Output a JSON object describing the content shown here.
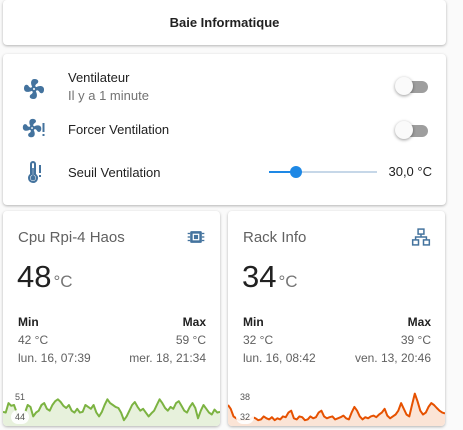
{
  "header": {
    "title": "Baie Informatique"
  },
  "entities": [
    {
      "icon": "fan-icon",
      "name": "Ventilateur",
      "secondary": "Il y a 1 minute",
      "type": "toggle",
      "state": "off"
    },
    {
      "icon": "fan-alert-icon",
      "name": "Forcer Ventilation",
      "type": "toggle",
      "state": "off"
    },
    {
      "icon": "thermometer-alert-icon",
      "name": "Seuil Ventilation",
      "type": "slider",
      "value_text": "30,0 °C",
      "level": 0.25
    }
  ],
  "sensors": [
    {
      "name": "Cpu Rpi-4 Haos",
      "icon": "chip-icon",
      "value": "48",
      "unit": "°C",
      "min_label": "Min",
      "max_label": "Max",
      "min_value": "42 °C",
      "max_value": "59 °C",
      "min_time": "lun. 16, 07:39",
      "max_time": "mer. 18, 21:34",
      "graph_color": "#7cb342",
      "graph_fill": "#e7f1dc",
      "graph_top_label": "51",
      "graph_bottom_label": "44",
      "graph_values": [
        0.32,
        0.3,
        0.55,
        0.48,
        0.5,
        0.3,
        0.12,
        0.15,
        0.3,
        0.5,
        0.45,
        0.2,
        0.3,
        0.35,
        0.5,
        0.55,
        0.4,
        0.35,
        0.5,
        0.6,
        0.65,
        0.58,
        0.48,
        0.42,
        0.5,
        0.35,
        0.3,
        0.4,
        0.3,
        0.32,
        0.5,
        0.45,
        0.4,
        0.5,
        0.3,
        0.2,
        0.32,
        0.5,
        0.65,
        0.55,
        0.5,
        0.45,
        0.42,
        0.3,
        0.1,
        0.2,
        0.35,
        0.5,
        0.58,
        0.45,
        0.35,
        0.4,
        0.3,
        0.2,
        0.28,
        0.35,
        0.5,
        0.65,
        0.55,
        0.42,
        0.35,
        0.45,
        0.4,
        0.55,
        0.6,
        0.48,
        0.35,
        0.3,
        0.45,
        0.55,
        0.42,
        0.15,
        0.35,
        0.5,
        0.4,
        0.3,
        0.25,
        0.38,
        0.3,
        0.32
      ]
    },
    {
      "name": "Rack Info",
      "icon": "network-icon",
      "value": "34",
      "unit": "°C",
      "min_label": "Min",
      "max_label": "Max",
      "min_value": "32 °C",
      "max_value": "39 °C",
      "min_time": "lun. 16, 08:42",
      "max_time": "ven. 13, 20:46",
      "graph_color": "#e65100",
      "graph_fill": "#fbe4d6",
      "graph_top_label": "38",
      "graph_bottom_label": "32",
      "graph_values": [
        0.5,
        0.4,
        0.2,
        0.15,
        0.1,
        0.12,
        0.1,
        0.15,
        0.12,
        0.18,
        0.15,
        0.1,
        0.12,
        0.2,
        0.15,
        0.12,
        0.18,
        0.1,
        0.15,
        0.12,
        0.2,
        0.18,
        0.3,
        0.35,
        0.15,
        0.12,
        0.2,
        0.18,
        0.1,
        0.12,
        0.2,
        0.15,
        0.18,
        0.3,
        0.35,
        0.2,
        0.15,
        0.18,
        0.2,
        0.12,
        0.15,
        0.18,
        0.22,
        0.15,
        0.12,
        0.3,
        0.45,
        0.35,
        0.2,
        0.12,
        0.18,
        0.15,
        0.2,
        0.22,
        0.18,
        0.25,
        0.3,
        0.4,
        0.22,
        0.15,
        0.2,
        0.25,
        0.35,
        0.55,
        0.4,
        0.25,
        0.2,
        0.5,
        0.8,
        0.6,
        0.35,
        0.25,
        0.3,
        0.45,
        0.55,
        0.5,
        0.42,
        0.35,
        0.3,
        0.28
      ]
    }
  ]
}
